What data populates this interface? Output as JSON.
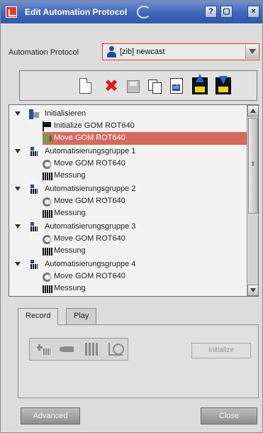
{
  "window": {
    "title": "Edit Automation Protocol",
    "controls": [
      "?",
      "▢",
      "×"
    ]
  },
  "protocol": {
    "label": "Automation Protocol",
    "value": "[zib] newcast",
    "icon": "user-icon"
  },
  "toolbar": {
    "icons": [
      "new-document-icon",
      "delete-icon",
      "save-icon",
      "copy-icon",
      "rename-icon",
      "upload-icon",
      "download-icon"
    ]
  },
  "tree": {
    "items": [
      {
        "label": "Initialisieren",
        "icon": "init-group-icon",
        "expanded": true
      },
      {
        "label": "Initialize GOM ROT640",
        "icon": "flag-icon"
      },
      {
        "label": "Move GOM ROT640",
        "icon": "move-icon",
        "selected": true
      },
      {
        "label": "Automatisierungsgruppe 1",
        "icon": "group-icon",
        "expanded": true
      },
      {
        "label": "Move GOM ROT640",
        "icon": "move-icon"
      },
      {
        "label": "Messung",
        "icon": "measure-icon"
      },
      {
        "label": "Automatisierungsgruppe 2",
        "icon": "group-icon",
        "expanded": true
      },
      {
        "label": "Move GOM ROT640",
        "icon": "move-icon"
      },
      {
        "label": "Messung",
        "icon": "measure-icon"
      },
      {
        "label": "Automatisierungsgruppe 3",
        "icon": "group-icon",
        "expanded": true
      },
      {
        "label": "Move GOM ROT640",
        "icon": "move-icon"
      },
      {
        "label": "Messung",
        "icon": "measure-icon"
      },
      {
        "label": "Automatisierungsgruppe 4",
        "icon": "group-icon",
        "expanded": true
      },
      {
        "label": "Move GOM ROT640",
        "icon": "move-icon"
      },
      {
        "label": "Messung",
        "icon": "measure-icon"
      }
    ]
  },
  "tabs": [
    {
      "label": "Record",
      "active": true
    },
    {
      "label": "Play",
      "active": false
    }
  ],
  "record_panel": {
    "tools": [
      "add-group-icon",
      "move-icon",
      "measure-icon",
      "fit-icon"
    ],
    "initialize_label": "Initialize"
  },
  "buttons": {
    "advanced_label": "Advanced",
    "close_label": "Close"
  },
  "colors": {
    "selection": "#d46a60",
    "title_bar": "#3f66b8",
    "accent_red": "#d23a32"
  }
}
